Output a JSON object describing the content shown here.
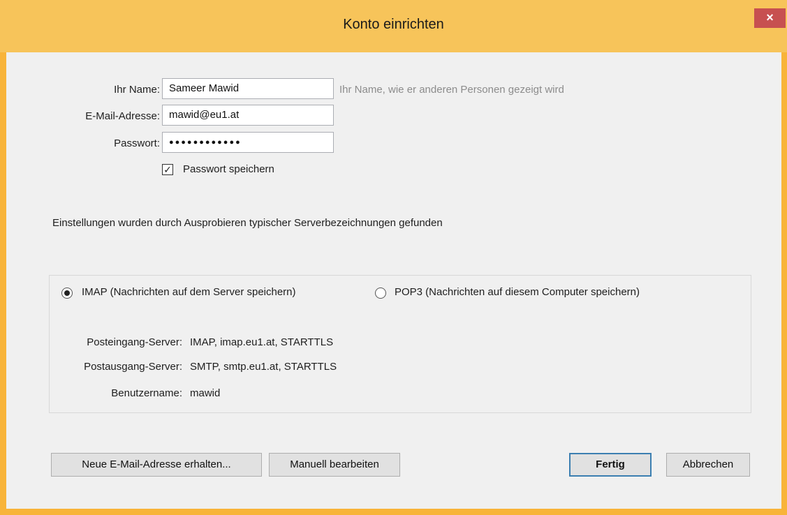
{
  "window": {
    "title": "Konto einrichten",
    "close_glyph": "×",
    "accent_color": "#f7c45a"
  },
  "form": {
    "name_label": "Ihr Name:",
    "name_value": "Sameer Mawid",
    "name_hint": "Ihr Name, wie er anderen Personen gezeigt wird",
    "email_label": "E-Mail-Adresse:",
    "email_value": "mawid@eu1.at",
    "password_label": "Passwort:",
    "password_value": "●●●●●●●●●●●●",
    "remember_password_label": "Passwort speichern",
    "remember_password_checked": true
  },
  "status_message": "Einstellungen wurden durch Ausprobieren typischer Serverbezeichnungen gefunden",
  "server": {
    "imap_label": "IMAP (Nachrichten auf dem Server speichern)",
    "pop3_label": "POP3 (Nachrichten auf diesem Computer speichern)",
    "selected": "IMAP",
    "incoming_label": "Posteingang-Server:",
    "incoming_value": "IMAP, imap.eu1.at, STARTTLS",
    "outgoing_label": "Postausgang-Server:",
    "outgoing_value": "SMTP, smtp.eu1.at, STARTTLS",
    "username_label": "Benutzername:",
    "username_value": "mawid"
  },
  "buttons": {
    "new_email": "Neue E-Mail-Adresse erhalten...",
    "manual_edit": "Manuell bearbeiten",
    "done": "Fertig",
    "cancel": "Abbrechen"
  }
}
